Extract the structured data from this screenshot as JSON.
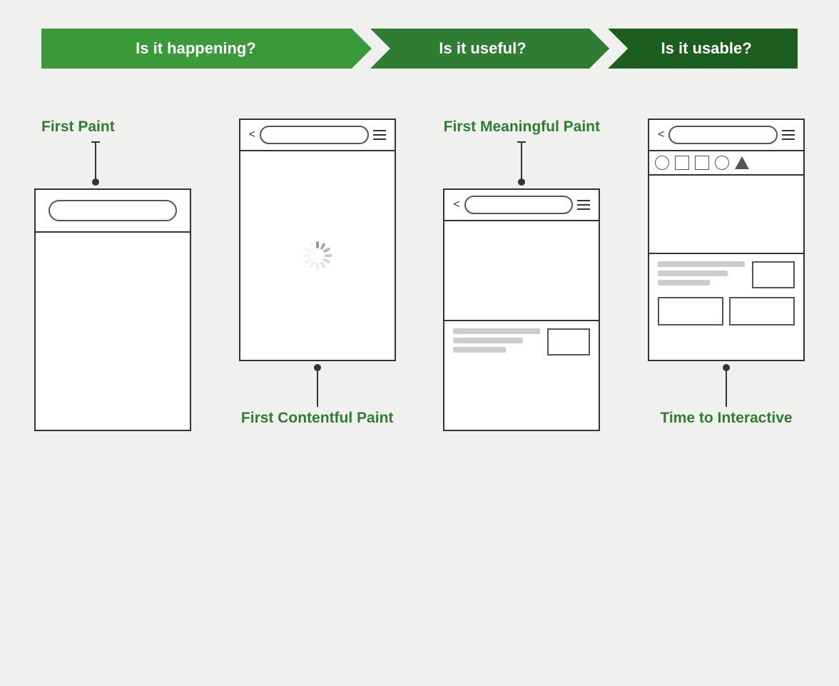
{
  "banner": {
    "arrow1": "Is it happening?",
    "arrow2": "Is it useful?",
    "arrow3": "Is it usable?"
  },
  "metrics": {
    "first_paint": "First Paint",
    "first_contentful_paint": "First Contentful Paint",
    "first_meaningful_paint": "First Meaningful Paint",
    "time_to_interactive": "Time to Interactive"
  },
  "colors": {
    "green_light": "#3a9a3a",
    "green_mid": "#2e7d32",
    "green_dark": "#1b5e20",
    "text_dark": "#1a1a1a"
  }
}
